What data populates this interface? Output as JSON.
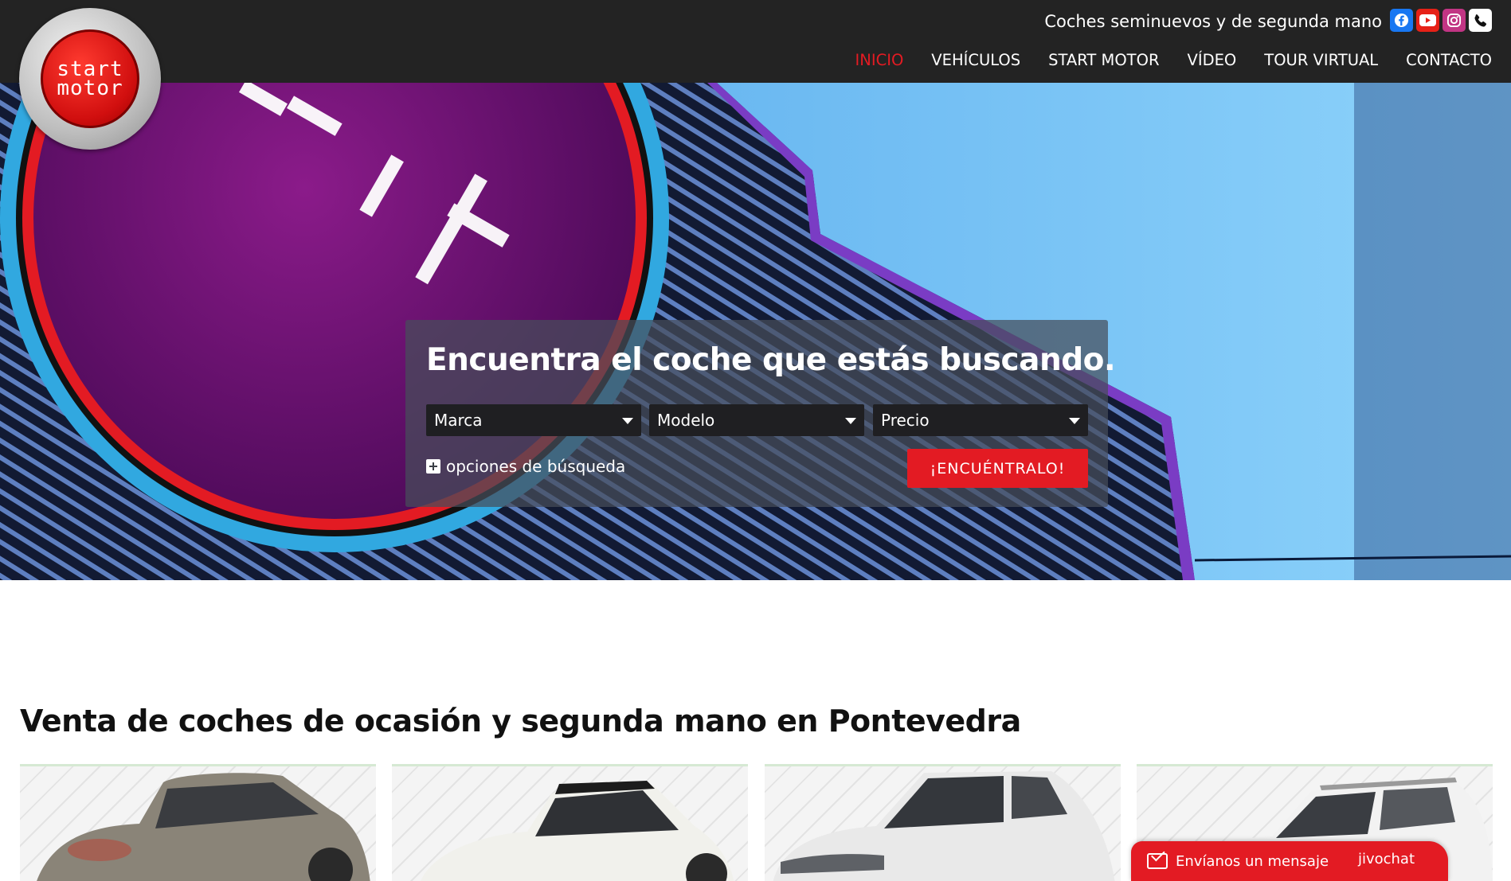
{
  "header": {
    "logo_line1": "start",
    "logo_line2": "motor",
    "tagline": "Coches seminuevos y de segunda mano",
    "social_icons": [
      "facebook-icon",
      "youtube-icon",
      "instagram-icon",
      "phone-icon"
    ],
    "nav": [
      {
        "label": "INICIO",
        "active": true
      },
      {
        "label": "VEHÍCULOS",
        "active": false
      },
      {
        "label": "START MOTOR",
        "active": false
      },
      {
        "label": "VÍDEO",
        "active": false
      },
      {
        "label": "TOUR VIRTUAL",
        "active": false
      },
      {
        "label": "CONTACTO",
        "active": false
      }
    ]
  },
  "hero": {
    "sign_text": "start motor",
    "search": {
      "title": "Encuentra el coche que estás buscando.",
      "brand_select": "Marca",
      "model_select": "Modelo",
      "price_select": "Precio",
      "options_label": "opciones de búsqueda",
      "submit_label": "¡ENCUÉNTRALO!"
    }
  },
  "main": {
    "title": "Venta de coches de ocasión y segunda mano en Pontevedra",
    "cars": [
      {
        "color": "#8a8478"
      },
      {
        "color": "#f1f1ec"
      },
      {
        "color": "#e9e9e9"
      },
      {
        "color": "#f2f2f2"
      }
    ]
  },
  "chat": {
    "label": "Envíanos un mensaje",
    "brand": "jivochat"
  },
  "colors": {
    "accent": "#e31b23",
    "topbar": "#232323"
  }
}
